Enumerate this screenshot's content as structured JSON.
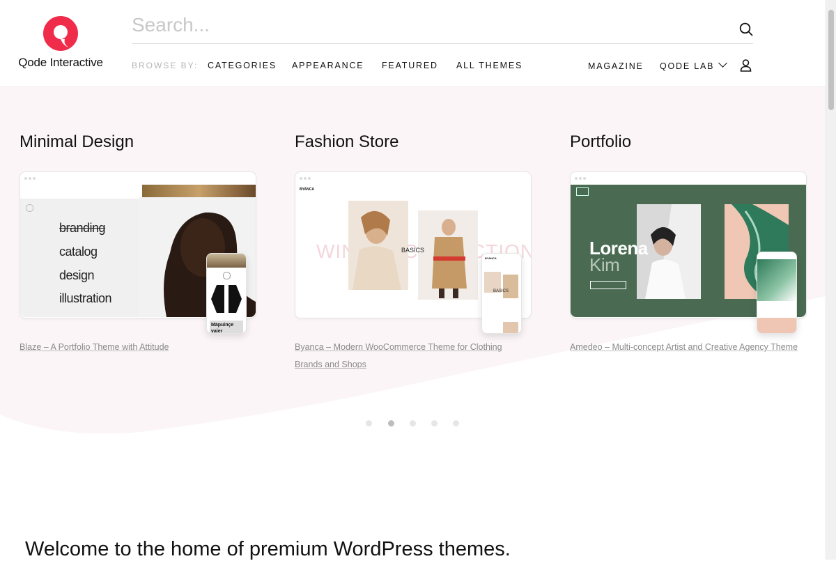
{
  "brand": {
    "name": "Qode Interactive",
    "accent": "#ef2c4a"
  },
  "search": {
    "placeholder": "Search...",
    "icon": "search-icon"
  },
  "browse": {
    "label": "BROWSE BY:",
    "items": [
      "CATEGORIES",
      "APPEARANCE",
      "FEATURED",
      "ALL THEMES"
    ]
  },
  "right_nav": {
    "magazine": "MAGAZINE",
    "qode_lab": "QODE LAB",
    "user_icon": "user-icon",
    "chevron_icon": "chevron-down-icon"
  },
  "cards": [
    {
      "title": "Minimal Design",
      "link": "Blaze – A Portfolio Theme with Attitude",
      "preview_words": [
        "branding",
        "catalog",
        "design",
        "illustration"
      ],
      "phone_text": "Mäpuinçe vaier"
    },
    {
      "title": "Fashion Store",
      "link": "Byanca – Modern WooCommerce Theme for Clothing Brands and Shops",
      "preview_bg_text": "WINTER COLLECTION",
      "preview_label": "BASICS",
      "brand_small": "BYANCA",
      "phone_label": "BASICS"
    },
    {
      "title": "Portfolio",
      "link": "Amedeo – Multi-concept Artist and Creative Agency Theme",
      "hero_line1": "Lorena",
      "hero_line2": "Kim",
      "bg_color": "#4a6b52"
    }
  ],
  "slider": {
    "count": 5,
    "active": 1
  },
  "welcome": {
    "heading": "Welcome to the home of premium WordPress themes."
  }
}
